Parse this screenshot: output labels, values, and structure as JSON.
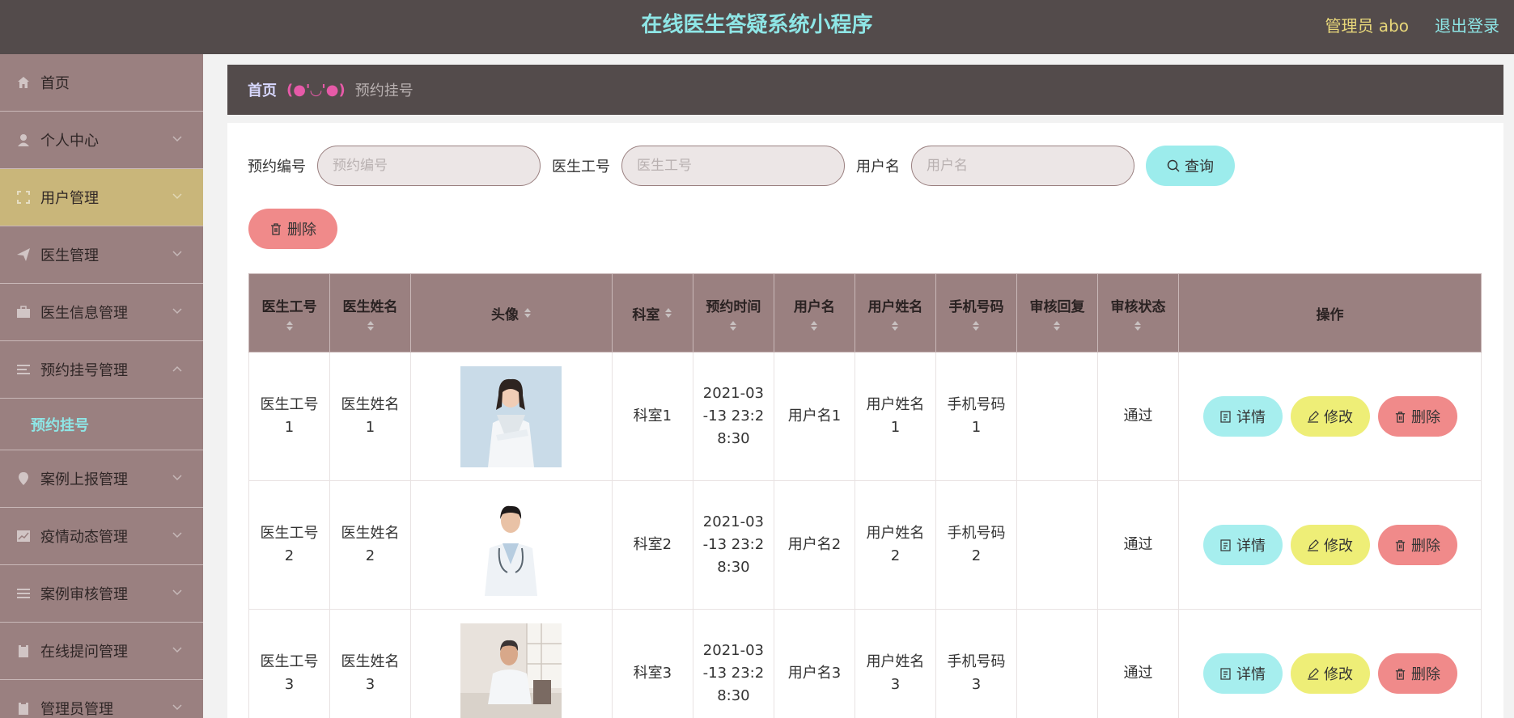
{
  "header": {
    "title": "在线医生答疑系统小程序",
    "admin": "管理员 abo",
    "logout": "退出登录"
  },
  "sidebar": {
    "items": [
      {
        "label": "首页",
        "icon": "home-icon"
      },
      {
        "label": "个人中心",
        "icon": "user-icon"
      },
      {
        "label": "用户管理",
        "icon": "expand-icon"
      },
      {
        "label": "医生管理",
        "icon": "send-icon"
      },
      {
        "label": "医生信息管理",
        "icon": "briefcase-icon"
      },
      {
        "label": "预约挂号管理",
        "icon": "list-icon"
      },
      {
        "label": "案例上报管理",
        "icon": "location-icon"
      },
      {
        "label": "疫情动态管理",
        "icon": "chart-icon"
      },
      {
        "label": "案例审核管理",
        "icon": "list-icon"
      },
      {
        "label": "在线提问管理",
        "icon": "clipboard-icon"
      },
      {
        "label": "管理员管理",
        "icon": "clipboard-icon"
      }
    ],
    "submenu": {
      "label": "预约挂号"
    }
  },
  "breadcrumb": {
    "home": "首页",
    "separator": "(●'◡'●)",
    "current": "预约挂号"
  },
  "search": {
    "fields": [
      {
        "label": "预约编号",
        "placeholder": "预约编号",
        "value": ""
      },
      {
        "label": "医生工号",
        "placeholder": "医生工号",
        "value": ""
      },
      {
        "label": "用户名",
        "placeholder": "用户名",
        "value": ""
      }
    ],
    "query_label": "查询",
    "delete_label": "删除"
  },
  "table": {
    "columns": [
      "医生工号",
      "医生姓名",
      "头像",
      "科室",
      "预约时间",
      "用户名",
      "用户姓名",
      "手机号码",
      "审核回复",
      "审核状态",
      "操作"
    ],
    "rows": [
      {
        "doctor_no": [
          "医生工号",
          "1"
        ],
        "doctor_name": [
          "医生姓名",
          "1"
        ],
        "department": "科室1",
        "time": [
          "2021-03",
          "-13 23:2",
          "8:30"
        ],
        "username": "用户名1",
        "user_fullname": [
          "用户姓名",
          "1"
        ],
        "phone": [
          "手机号码",
          "1"
        ],
        "reply": "",
        "status": "通过"
      },
      {
        "doctor_no": [
          "医生工号",
          "2"
        ],
        "doctor_name": [
          "医生姓名",
          "2"
        ],
        "department": "科室2",
        "time": [
          "2021-03",
          "-13 23:2",
          "8:30"
        ],
        "username": "用户名2",
        "user_fullname": [
          "用户姓名",
          "2"
        ],
        "phone": [
          "手机号码",
          "2"
        ],
        "reply": "",
        "status": "通过"
      },
      {
        "doctor_no": [
          "医生工号",
          "3"
        ],
        "doctor_name": [
          "医生姓名",
          "3"
        ],
        "department": "科室3",
        "time": [
          "2021-03",
          "-13 23:2",
          "8:30"
        ],
        "username": "用户名3",
        "user_fullname": [
          "用户姓名",
          "3"
        ],
        "phone": [
          "手机号码",
          "3"
        ],
        "reply": "",
        "status": "通过"
      }
    ],
    "actions": {
      "detail": "详情",
      "edit": "修改",
      "delete": "删除"
    }
  },
  "colors": {
    "topbar": "#534b4b",
    "title": "#8ee6e6",
    "sidebar": "#9a8080",
    "sidebar_active": "#c9b67a",
    "query_button": "#9cecec",
    "edit_button": "#eeee77",
    "delete_button": "#f08a8a"
  }
}
